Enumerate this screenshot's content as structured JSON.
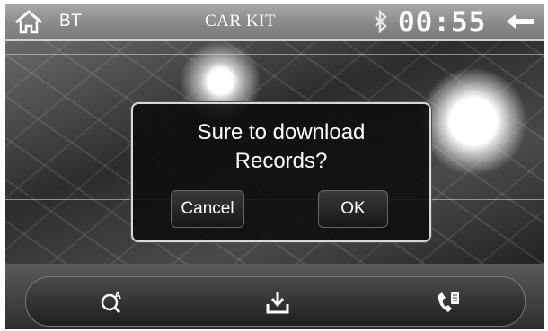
{
  "header": {
    "section_label": "BT",
    "title": "CAR KIT",
    "clock": "00:55",
    "home_icon": "home-icon",
    "bluetooth_icon": "bluetooth-icon",
    "back_icon": "back-arrow-icon"
  },
  "dialog": {
    "message_line1": "Sure to download",
    "message_line2": "Records?",
    "cancel_label": "Cancel",
    "ok_label": "OK"
  },
  "bottom_bar": {
    "buttons": [
      {
        "icon": "search-contact-icon"
      },
      {
        "icon": "download-icon"
      },
      {
        "icon": "phonebook-icon"
      }
    ]
  },
  "colors": {
    "header_bg": "#8a8a8a",
    "dialog_bg": "#0c0c0c",
    "text": "#ffffff"
  }
}
